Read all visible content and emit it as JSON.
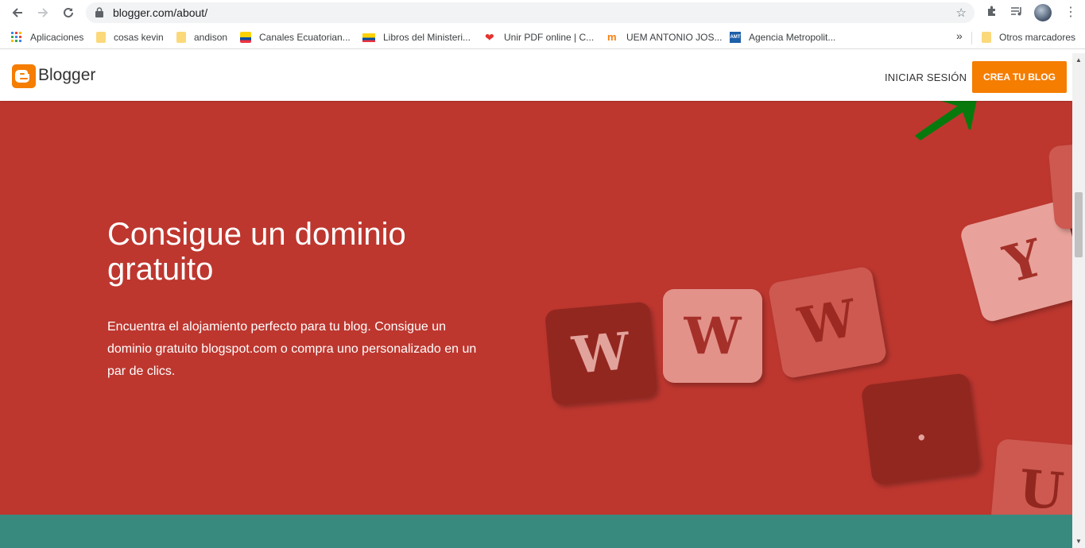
{
  "browser": {
    "url": "blogger.com/about/",
    "bookmarks": [
      {
        "label": "Aplicaciones",
        "icon": "apps-grid-icon"
      },
      {
        "label": "cosas kevin",
        "icon": "folder-icon"
      },
      {
        "label": "andison",
        "icon": "folder-icon"
      },
      {
        "label": "Canales Ecuatorian...",
        "icon": "ecuador-flag-icon"
      },
      {
        "label": "Libros del Ministeri...",
        "icon": "ecuador-flag-icon"
      },
      {
        "label": "Unir PDF online | C...",
        "icon": "heart-icon"
      },
      {
        "label": "UEM ANTONIO JOS...",
        "icon": "moodle-icon"
      },
      {
        "label": "Agencia Metropolit...",
        "icon": "amt-icon"
      }
    ],
    "bookmarks_overflow": "»",
    "other_bookmarks": "Otros marcadores"
  },
  "site": {
    "brand": "Blogger",
    "signin_label": "INICIAR SESIÓN",
    "cta_label": "CREA TU BLOG",
    "accent_color": "#f57d00",
    "hero": {
      "title": "Consigue un dominio gratuito",
      "description": "Encuentra el alojamiento perfecto para tu blog. Consigue un dominio gratuito blogspot.com o compra uno personalizado en un par de clics.",
      "background_color": "#bd372f"
    },
    "tiles": [
      "W",
      "W",
      "W",
      "Y",
      ".",
      "U"
    ],
    "next_section_color": "#388a7e"
  }
}
